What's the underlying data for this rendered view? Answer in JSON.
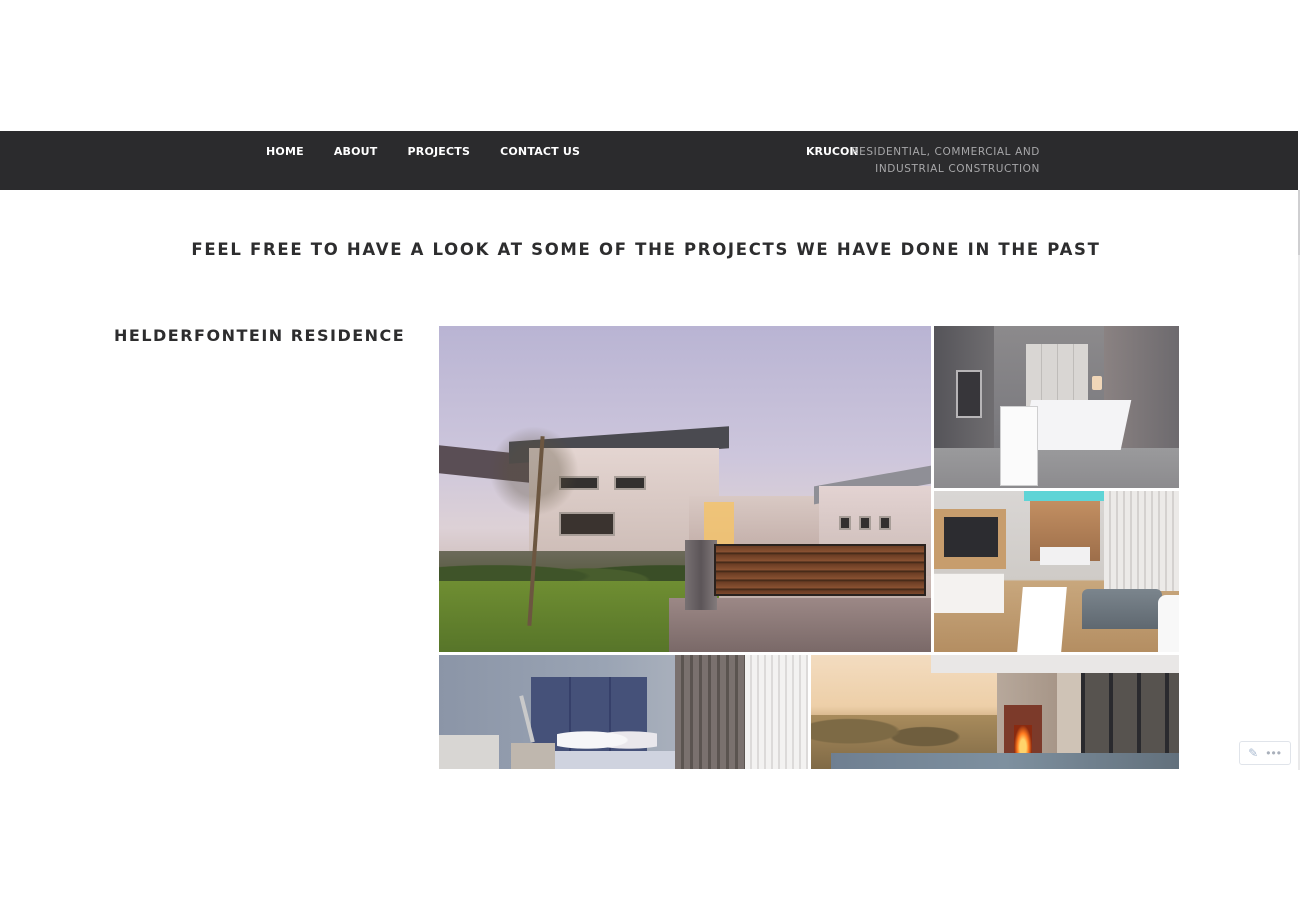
{
  "nav": {
    "items": [
      {
        "label": "HOME"
      },
      {
        "label": "ABOUT"
      },
      {
        "label": "PROJECTS"
      },
      {
        "label": "CONTACT US"
      }
    ],
    "brand": "KRUCON",
    "tagline_line1": "RESIDENTIAL, COMMERCIAL AND",
    "tagline_line2": "INDUSTRIAL CONSTRUCTION"
  },
  "main": {
    "heading": "FEEL FREE TO HAVE A LOOK AT SOME OF THE PROJECTS WE HAVE DONE IN THE PAST",
    "project": {
      "title": "HELDERFONTEIN RESIDENCE",
      "images": [
        {
          "subject": "house-exterior-dusk"
        },
        {
          "subject": "bedroom-grey"
        },
        {
          "subject": "lounge-bedroom"
        },
        {
          "subject": "blue-bedroom"
        },
        {
          "subject": "patio-fireplace"
        }
      ]
    }
  },
  "edit_widget": {
    "icons": [
      "pencil-icon",
      "more-icon"
    ],
    "more_glyph": "•••"
  },
  "colors": {
    "navbar": "#2b2b2d",
    "heading": "#2d2d2e",
    "tagline": "#a7a7a9"
  }
}
